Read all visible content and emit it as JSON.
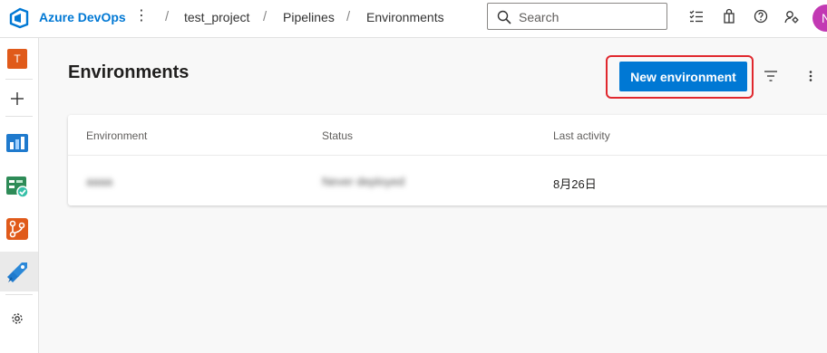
{
  "header": {
    "brand": "Azure DevOps",
    "more": "⋮",
    "breadcrumbs": [
      {
        "label": "test_project"
      },
      {
        "label": "Pipelines"
      },
      {
        "label": "Environments"
      }
    ],
    "separator": "/",
    "search": {
      "placeholder": "Search"
    },
    "user": {
      "initial": "N",
      "avatar_color": "#c239b3"
    }
  },
  "rail": {
    "project_initial": "T",
    "items": [
      {
        "icon": "add-icon"
      },
      {
        "icon": "boards-icon"
      },
      {
        "icon": "test-plans-icon"
      },
      {
        "icon": "repos-icon"
      },
      {
        "icon": "pipelines-icon"
      },
      {
        "icon": "gear-icon"
      }
    ]
  },
  "page": {
    "title": "Environments",
    "new_button": "New environment",
    "accent": "#0078d4",
    "highlight_color": "#e0282e"
  },
  "table": {
    "columns": [
      "Environment",
      "Status",
      "Last activity"
    ],
    "rows": [
      {
        "environment": "aaaa",
        "status": "Never deployed",
        "last_activity": "8月26日"
      }
    ]
  }
}
